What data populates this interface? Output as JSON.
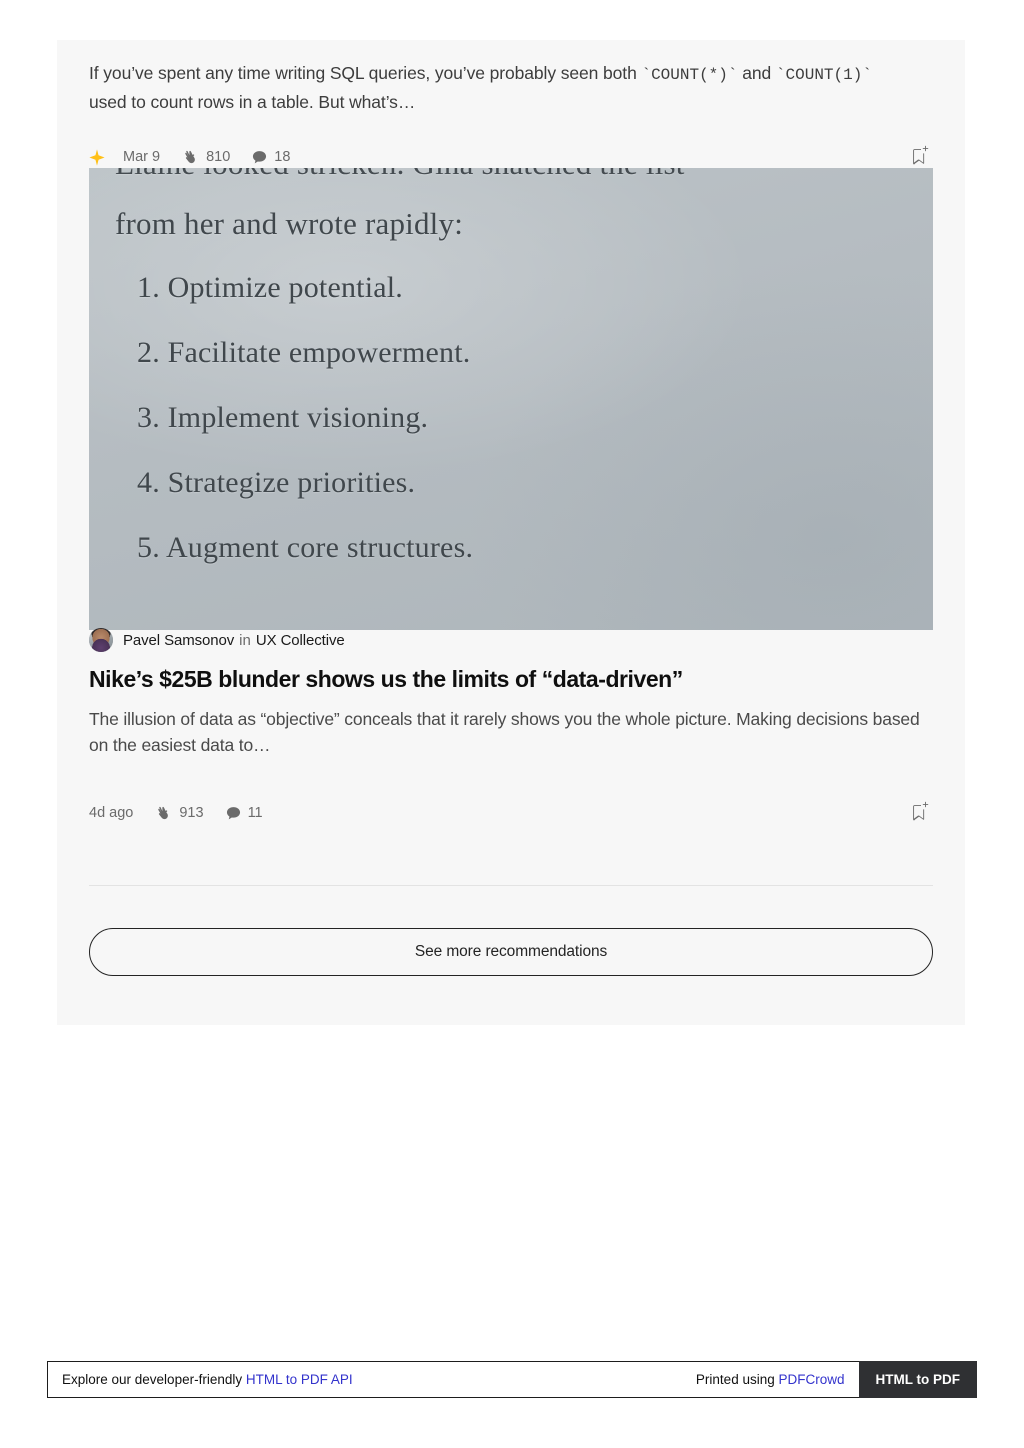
{
  "card": {
    "story_partial": {
      "excerpt_part1": "If you’ve spent any time writing SQL queries, you’ve probably seen both ",
      "excerpt_code1": "`COUNT(*)`",
      "excerpt_part2": " and ",
      "excerpt_code2": "`COUNT(1)`",
      "excerpt_part3": " used to count rows in a table. But what’s…",
      "meta": {
        "star_icon": "sparkle-star-icon",
        "date": "Mar 9",
        "clap_icon": "clap-hand-icon",
        "claps": "810",
        "comment_icon": "speech-bubble-icon",
        "comments": "18",
        "bookmark_icon": "bookmark-add-icon"
      }
    },
    "hero_photo": {
      "alt": "photograph of a printed page of a novel",
      "lines": [
        "Elaine looked stricken. Gina snatched the list",
        "from her and wrote rapidly:",
        "1. Optimize potential.",
        "2. Facilitate empowerment.",
        "3. Implement visioning.",
        "4. Strategize priorities.",
        "5. Augment core structures."
      ]
    },
    "story": {
      "avatar": "author-avatar",
      "author": "Pavel Samsonov",
      "preposition": "in",
      "publication": "UX Collective",
      "title": "Nike’s $25B blunder shows us the limits of “data-driven”",
      "subtitle": "The illusion of data as “objective” conceals that it rarely shows you the whole picture. Making decisions based on the easiest data to…",
      "meta": {
        "date": "4d ago",
        "clap_icon": "clap-hand-icon",
        "claps": "913",
        "comment_icon": "speech-bubble-icon",
        "comments": "11",
        "bookmark_icon": "bookmark-add-icon"
      }
    },
    "see_more_label": "See more recommendations"
  },
  "footer": {
    "left_text": "Explore our developer-friendly ",
    "left_link": "HTML to PDF API",
    "right_text": "Printed using ",
    "right_link": "PDFCrowd",
    "cta_label": "HTML to PDF"
  },
  "colors": {
    "accent_star": "#FFC017",
    "link_blue": "#3333CC",
    "cta_dark": "#2F3033",
    "card_bg": "#F7F7F7",
    "photo_bg": "#B7BEC3"
  }
}
